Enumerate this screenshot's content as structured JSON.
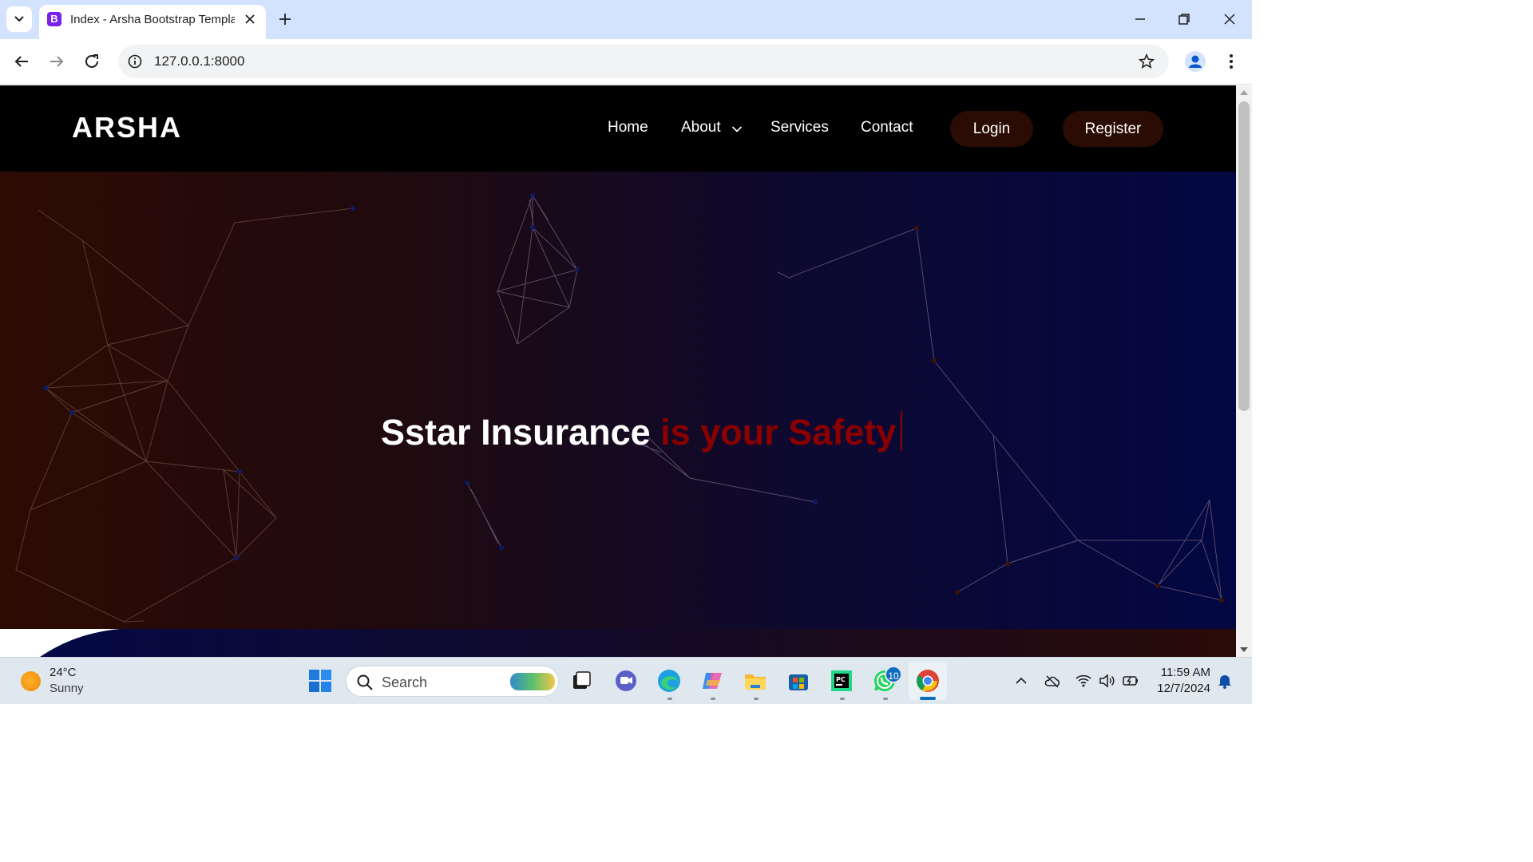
{
  "browser": {
    "tab_title": "Index - Arsha Bootstrap Templa",
    "tab_favicon_letter": "B",
    "url": "127.0.0.1:8000"
  },
  "site": {
    "logo": "ARSHA",
    "nav": {
      "home": "Home",
      "about": "About",
      "services": "Services",
      "contact": "Contact",
      "login": "Login",
      "register": "Register"
    },
    "hero": {
      "main_text": "Sstar Insurance",
      "accent_text": " is your Safety"
    },
    "colors": {
      "header_bg": "#000000",
      "button_bg": "#2b0c04",
      "hero_left": "#2d0b03",
      "hero_right": "#030842",
      "accent": "#8a0000"
    }
  },
  "taskbar": {
    "weather_temp": "24°C",
    "weather_desc": "Sunny",
    "search_placeholder": "Search",
    "whatsapp_badge": "10",
    "time": "11:59 AM",
    "date": "12/7/2024",
    "apps": [
      "windows-start-icon",
      "search-icon",
      "task-view-icon",
      "teams-icon",
      "edge-icon",
      "copilot-icon",
      "file-explorer-icon",
      "microsoft-store-icon",
      "pycharm-icon",
      "whatsapp-icon",
      "chrome-icon"
    ],
    "tray": [
      "chevron-up-icon",
      "onedrive-icon",
      "wifi-icon",
      "volume-icon",
      "battery-icon",
      "bell-icon"
    ]
  }
}
